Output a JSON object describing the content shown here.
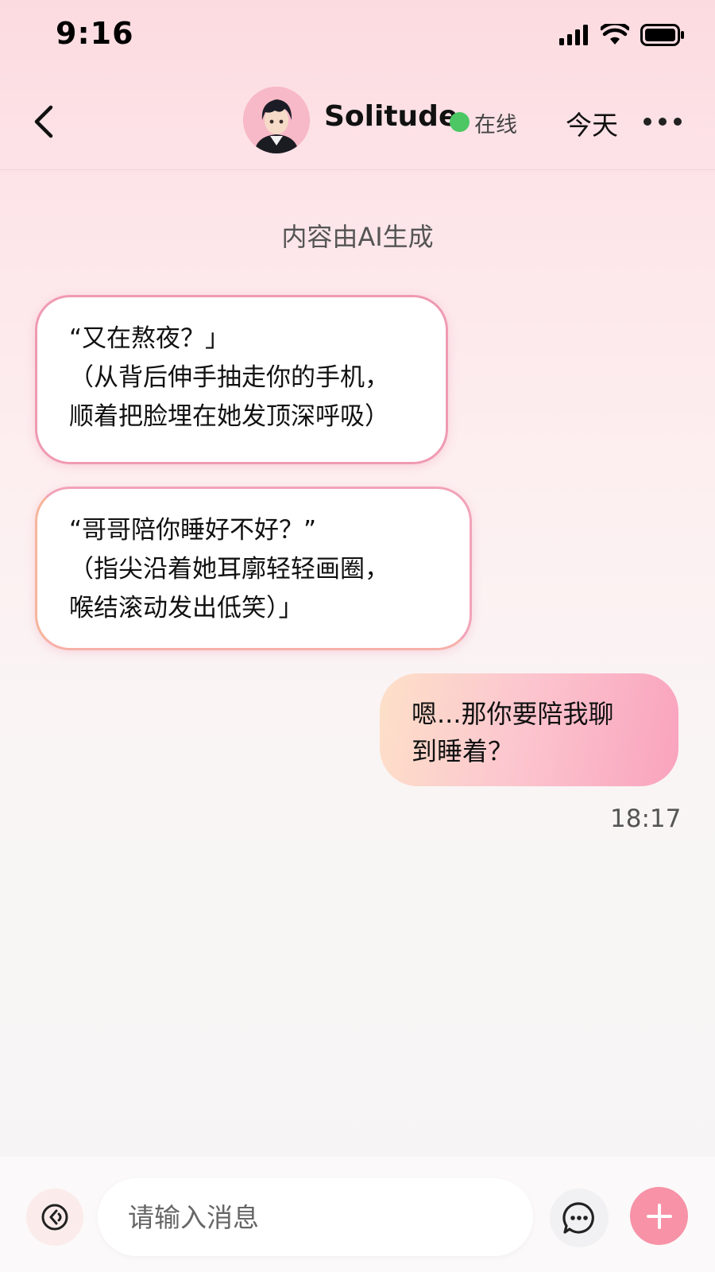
{
  "status_bar": {
    "time": "9:16"
  },
  "header": {
    "back_icon": "chevron-left-icon",
    "name": "Solitude",
    "status": "在线",
    "status_color": "#4cc764",
    "today_label": "今天",
    "more_icon": "more-horizontal-icon"
  },
  "notice": "内容由AI生成",
  "messages": [
    {
      "sender": "Solitude",
      "lines": [
        "“又在熬夜？」",
        "（从背后伸手抽走你的手机，",
        "顺着把脸埋在她发顶深呼吸）"
      ]
    },
    {
      "sender": "Solitude",
      "lines": [
        "“哥哥陪你睡好不好？”",
        "（指尖沿着她耳廓轻轻画圈，",
        "喉结滚动发出低笑）」"
      ]
    },
    {
      "sender": "me",
      "lines": [
        "嗯...那你要陪我聊",
        "到睡着？"
      ]
    }
  ],
  "last_message_time": "18:17",
  "composer": {
    "placeholder": "请输入消息",
    "voice_icon": "voice-icon",
    "chat_icon": "chat-bubble-icon",
    "plus_icon": "plus-icon",
    "accent_color": "#f792a7"
  }
}
